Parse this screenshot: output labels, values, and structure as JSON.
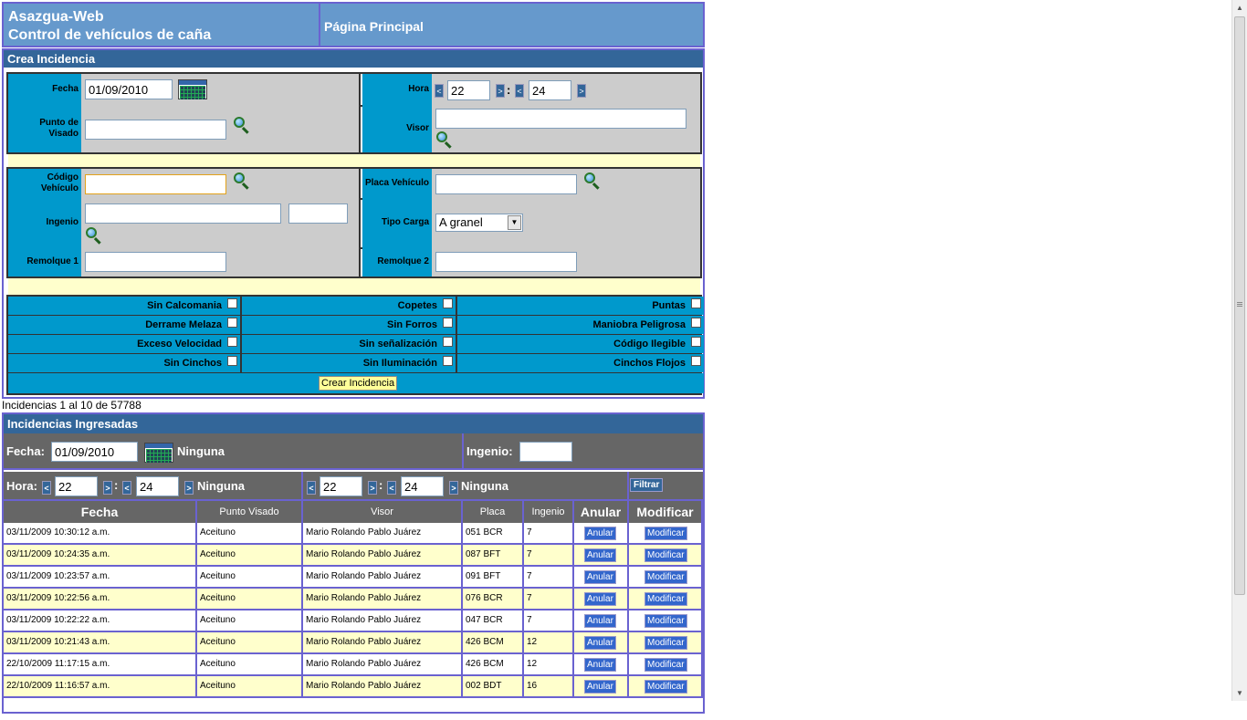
{
  "header": {
    "app_line1": "Asazgua-Web",
    "app_line2": "Control de vehículos de caña",
    "page_title": "Página Principal"
  },
  "form": {
    "section_title": "Crea Incidencia",
    "fecha_label": "Fecha",
    "fecha_value": "01/09/2010",
    "hora_label": "Hora",
    "hora_h": "22",
    "hora_m": "24",
    "punto_label": "Punto de Visado",
    "visor_label": "Visor",
    "codigo_label": "Código Vehículo",
    "placa_label": "Placa Vehículo",
    "ingenio_label": "Ingenio",
    "tipo_label": "Tipo Carga",
    "tipo_value": "A granel",
    "rem1_label": "Remolque 1",
    "rem2_label": "Remolque 2",
    "checks": [
      [
        "Sin Calcomania",
        "Copetes",
        "Puntas"
      ],
      [
        "Derrame Melaza",
        "Sin Forros",
        "Maniobra Peligrosa"
      ],
      [
        "Exceso Velocidad",
        "Sin señalización",
        "Código Ilegible"
      ],
      [
        "Sin Cinchos",
        "Sin Iluminación",
        "Cinchos Flojos"
      ]
    ],
    "create_button": "Crear Incidencia"
  },
  "count_text": "Incidencias 1 al 10 de 57788",
  "list": {
    "section_title": "Incidencias Ingresadas",
    "fecha_label": "Fecha:",
    "fecha_value": "01/09/2010",
    "fecha_none": "Ninguna",
    "ingenio_label": "Ingenio:",
    "hora_label": "Hora:",
    "h1": "22",
    "m1": "24",
    "none1": "Ninguna",
    "h2": "22",
    "m2": "24",
    "none2": "Ninguna",
    "filter_button": "Filtrar",
    "columns": [
      "Fecha",
      "Punto Visado",
      "Visor",
      "Placa",
      "Ingenio",
      "Anular",
      "Modificar"
    ],
    "anular_label": "Anular",
    "modificar_label": "Modificar",
    "rows": [
      [
        "03/11/2009 10:30:12 a.m.",
        "Aceituno",
        "Mario Rolando Pablo Juárez",
        "051 BCR",
        "7"
      ],
      [
        "03/11/2009 10:24:35 a.m.",
        "Aceituno",
        "Mario Rolando Pablo Juárez",
        "087 BFT",
        "7"
      ],
      [
        "03/11/2009 10:23:57 a.m.",
        "Aceituno",
        "Mario Rolando Pablo Juárez",
        "091 BFT",
        "7"
      ],
      [
        "03/11/2009 10:22:56 a.m.",
        "Aceituno",
        "Mario Rolando Pablo Juárez",
        "076 BCR",
        "7"
      ],
      [
        "03/11/2009 10:22:22 a.m.",
        "Aceituno",
        "Mario Rolando Pablo Juárez",
        "047 BCR",
        "7"
      ],
      [
        "03/11/2009 10:21:43 a.m.",
        "Aceituno",
        "Mario Rolando Pablo Juárez",
        "426 BCM",
        "12"
      ],
      [
        "22/10/2009 11:17:15 a.m.",
        "Aceituno",
        "Mario Rolando Pablo Juárez",
        "426 BCM",
        "12"
      ],
      [
        "22/10/2009 11:16:57 a.m.",
        "Aceituno",
        "Mario Rolando Pablo Juárez",
        "002 BDT",
        "16"
      ]
    ]
  },
  "colors": {
    "header_bg": "#6699cc",
    "section_bar": "#336699",
    "label_bg": "#0099cc",
    "field_bg": "#cccccc",
    "filter_bg": "#666666",
    "alt_row": "#ffffcc",
    "border": "#6a62d0"
  }
}
